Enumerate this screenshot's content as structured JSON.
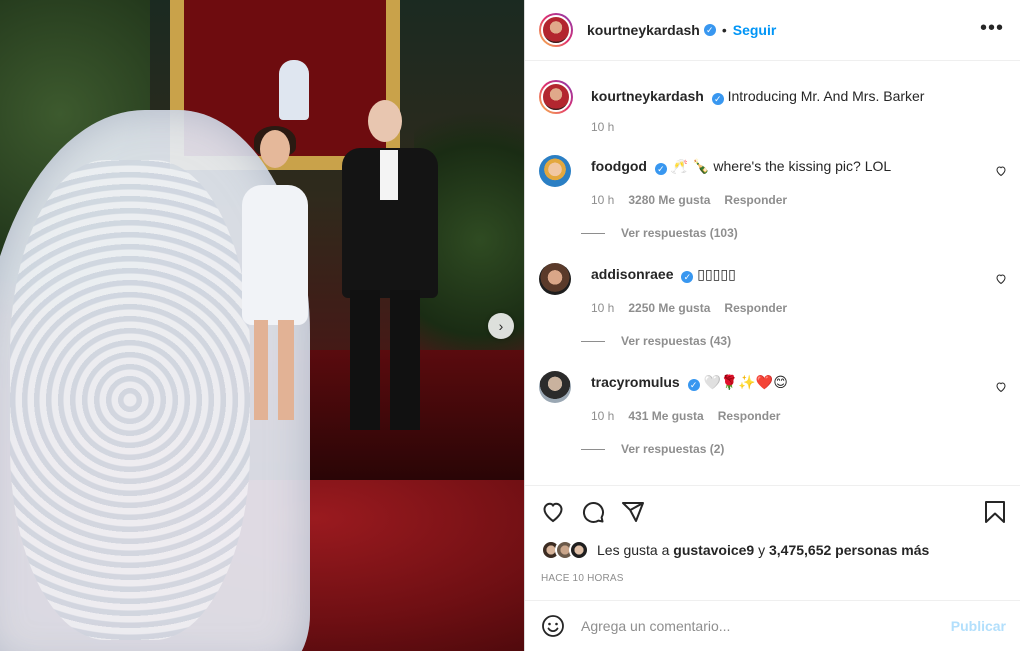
{
  "post": {
    "author": "kourtneykardash",
    "follow_label": "Seguir",
    "separator": "•",
    "more_label": "•••",
    "caption": {
      "user": "kourtneykardash",
      "text": "Introducing Mr. And Mrs. Barker",
      "time": "10 h"
    }
  },
  "comments": [
    {
      "user": "foodgod",
      "text": "🥂 🍾 where's the kissing pic? LOL",
      "time": "10 h",
      "likes": "3280 Me gusta",
      "reply_label": "Responder",
      "view_replies": "Ver respuestas (103)"
    },
    {
      "user": "addisonraee",
      "text": "▯▯▯▯▯",
      "time": "10 h",
      "likes": "2250 Me gusta",
      "reply_label": "Responder",
      "view_replies": "Ver respuestas (43)"
    },
    {
      "user": "tracyromulus",
      "text": "🤍🌹✨❤️😊",
      "time": "10 h",
      "likes": "431 Me gusta",
      "reply_label": "Responder",
      "view_replies": "Ver respuestas (2)"
    }
  ],
  "likes_summary": {
    "prefix": "Les gusta a",
    "user": "gustavoice9",
    "middle": "y",
    "count": "3,475,652 personas más"
  },
  "time_ago": "HACE 10 HORAS",
  "add_comment": {
    "placeholder": "Agrega un comentario...",
    "publish_label": "Publicar"
  },
  "photo": {
    "next_label": "›"
  },
  "icons": {
    "verified": "✓"
  },
  "colors": {
    "accent": "#0095f6",
    "verified": "#3897f0",
    "publish_disabled": "#b2dffc",
    "muted": "#8e8e8e"
  }
}
